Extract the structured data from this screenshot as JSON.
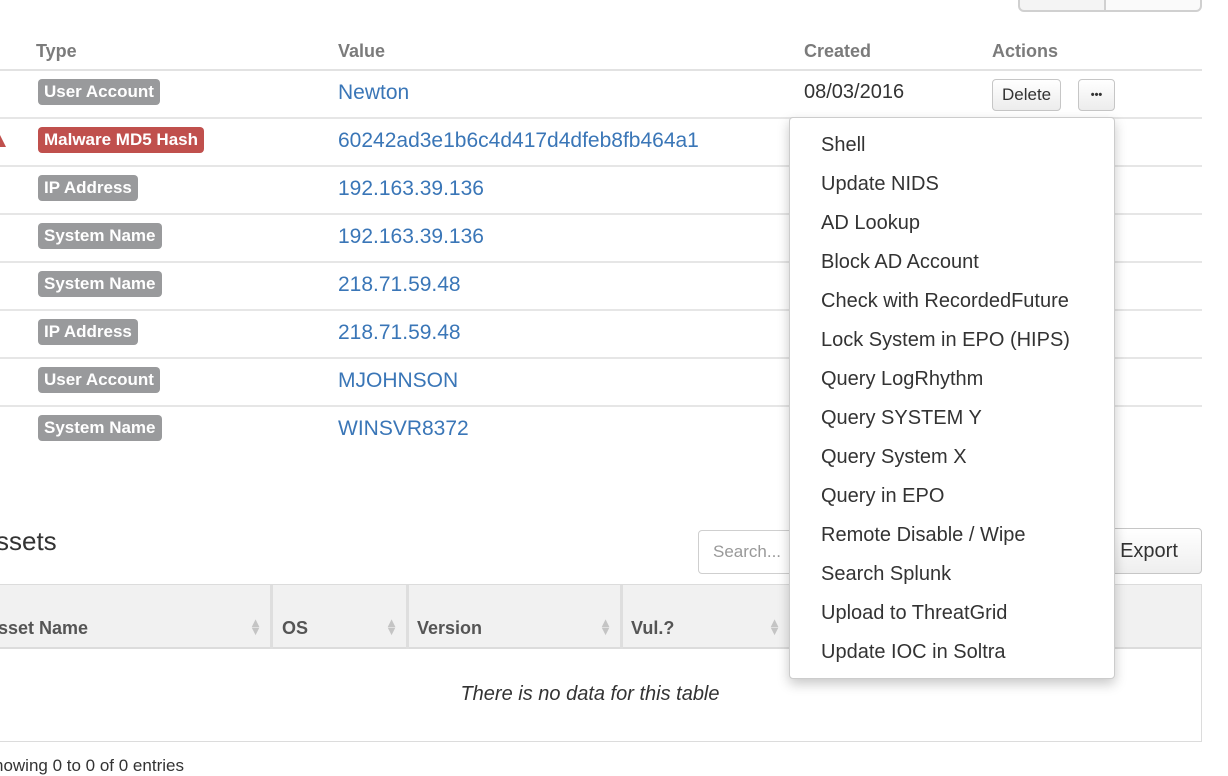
{
  "ioc_table": {
    "headers": {
      "type": "Type",
      "value": "Value",
      "created": "Created",
      "actions": "Actions"
    },
    "rows": [
      {
        "type": "User Account",
        "type_color": "gray",
        "value": "Newton",
        "created": "08/03/2016"
      },
      {
        "type": "Malware MD5 Hash",
        "type_color": "red",
        "value": "60242ad3e1b6c4d417d4dfeb8fb464a1"
      },
      {
        "type": "IP Address",
        "type_color": "gray",
        "value": "192.163.39.136"
      },
      {
        "type": "System Name",
        "type_color": "gray",
        "value": "192.163.39.136"
      },
      {
        "type": "System Name",
        "type_color": "gray",
        "value": "218.71.59.48"
      },
      {
        "type": "IP Address",
        "type_color": "gray",
        "value": "218.71.59.48"
      },
      {
        "type": "User Account",
        "type_color": "gray",
        "value": "MJOHNSON"
      },
      {
        "type": "System Name",
        "type_color": "gray",
        "value": "WINSVR8372"
      }
    ],
    "delete_label": "Delete",
    "more_label": "•••"
  },
  "actions_menu": {
    "items": [
      "Shell",
      "Update NIDS",
      "AD Lookup",
      "Block AD Account",
      "Check with RecordedFuture",
      "Lock System in EPO (HIPS)",
      "Query LogRhythm",
      "Query SYSTEM Y",
      "Query System X",
      "Query in EPO",
      "Remote Disable / Wipe",
      "Search Splunk",
      "Upload to ThreatGrid",
      "Update IOC in Soltra"
    ]
  },
  "assets": {
    "title": "ssets",
    "search_placeholder": "Search...",
    "export_label": "Export",
    "columns": [
      "sset Name",
      "OS",
      "Version",
      "Vul.?"
    ],
    "empty_message": "There is no data for this table",
    "showing": "howing 0 to 0 of 0 entries"
  },
  "colors": {
    "link": "#3a76b7",
    "badge_gray": "#999a9c",
    "badge_red": "#c0504d"
  },
  "icons": {
    "sort": "sort-icon",
    "warning": "warning-icon",
    "more": "ellipsis-icon"
  }
}
